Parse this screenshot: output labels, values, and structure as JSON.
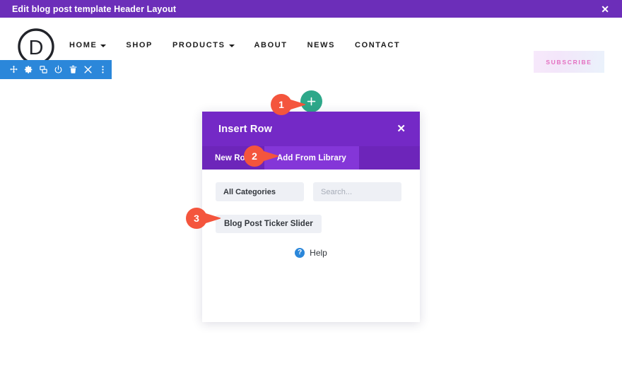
{
  "topbar": {
    "title": "Edit blog post template Header Layout",
    "close_icon": "close-icon",
    "close_glyph": "✕",
    "bg_color": "#6c2eb9"
  },
  "site_header": {
    "logo_letter": "D",
    "nav_items": [
      {
        "label": "HOME",
        "has_caret": true
      },
      {
        "label": "SHOP",
        "has_caret": false
      },
      {
        "label": "PRODUCTS",
        "has_caret": true
      },
      {
        "label": "ABOUT",
        "has_caret": false
      },
      {
        "label": "NEWS",
        "has_caret": false
      },
      {
        "label": "CONTACT",
        "has_caret": false
      }
    ],
    "subscribe_label": "SUBSCRIBE",
    "subscribe_text_color": "#e46fc0"
  },
  "section_toolbar": {
    "bg_color": "#2b87da",
    "icons": [
      "move-icon",
      "gear-icon",
      "duplicate-icon",
      "power-icon",
      "trash-icon",
      "close-icon",
      "more-options-icon"
    ]
  },
  "add_row_button": {
    "icon": "plus-icon",
    "color": "#2ea88a"
  },
  "modal": {
    "title": "Insert Row",
    "close_icon": "close-icon",
    "close_glyph": "✕",
    "header_color": "#7429c6",
    "tabs": [
      {
        "label": "New Row",
        "active": false
      },
      {
        "label": "Add From Library",
        "active": true
      }
    ],
    "category_filter": {
      "value": "All Categories",
      "icon": "chevron-down-icon"
    },
    "search": {
      "value": "",
      "placeholder": "Search..."
    },
    "library_items": [
      {
        "label": "Blog Post Ticker Slider"
      }
    ],
    "help": {
      "icon": "question-mark-icon",
      "glyph": "?",
      "label": "Help"
    }
  },
  "markers": [
    {
      "number": "1",
      "color": "#f4553d"
    },
    {
      "number": "2",
      "color": "#f4553d"
    },
    {
      "number": "3",
      "color": "#f4553d"
    }
  ]
}
